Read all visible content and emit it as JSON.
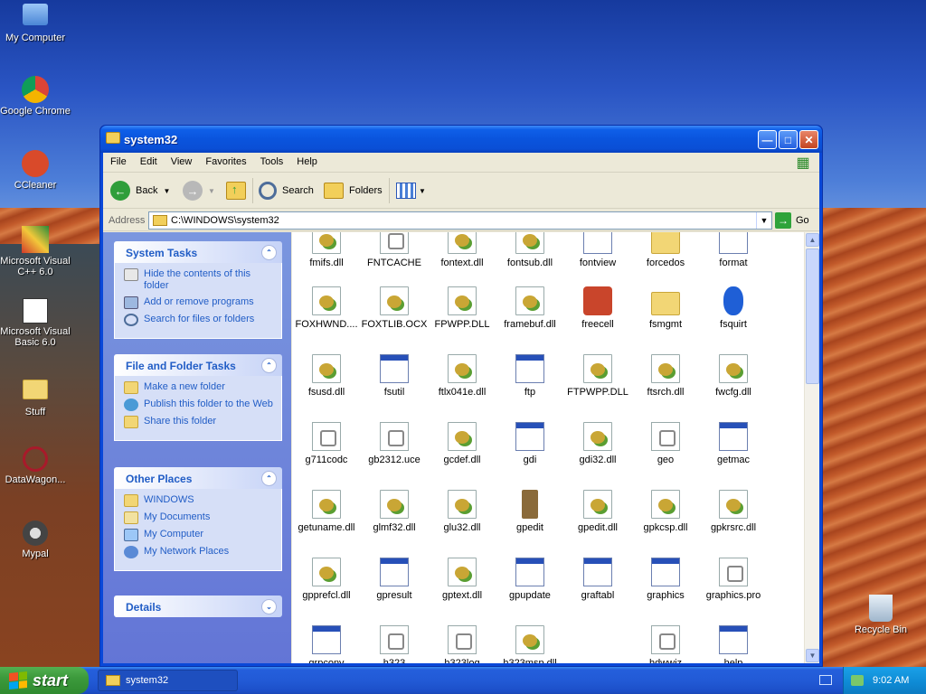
{
  "desktop": {
    "icons": [
      {
        "label": "My Computer",
        "icon": "computer-icon"
      },
      {
        "label": "Google Chrome",
        "icon": "chrome-icon"
      },
      {
        "label": "CCleaner",
        "icon": "ccleaner-icon"
      },
      {
        "label": "Microsoft Visual C++ 6.0",
        "icon": "visual-cpp-icon"
      },
      {
        "label": "Microsoft Visual Basic 6.0",
        "icon": "visual-basic-icon"
      },
      {
        "label": "Stuff",
        "icon": "folder-icon"
      },
      {
        "label": "DataWagon...",
        "icon": "datawagon-icon"
      },
      {
        "label": "Mypal",
        "icon": "mypal-icon"
      },
      {
        "label": "Recycle Bin",
        "icon": "recycle-bin-icon"
      }
    ]
  },
  "window": {
    "title": "system32",
    "menu": [
      "File",
      "Edit",
      "View",
      "Favorites",
      "Tools",
      "Help"
    ],
    "toolbar": {
      "back": "Back",
      "search": "Search",
      "folders": "Folders"
    },
    "address": {
      "label": "Address",
      "value": "C:\\WINDOWS\\system32",
      "go": "Go"
    }
  },
  "taskpane": {
    "system_tasks": {
      "title": "System Tasks",
      "items": [
        "Hide the contents of this folder",
        "Add or remove programs",
        "Search for files or folders"
      ]
    },
    "file_folder_tasks": {
      "title": "File and Folder Tasks",
      "items": [
        "Make a new folder",
        "Publish this folder to the Web",
        "Share this folder"
      ]
    },
    "other_places": {
      "title": "Other Places",
      "items": [
        "WINDOWS",
        "My Documents",
        "My Computer",
        "My Network Places"
      ]
    },
    "details": {
      "title": "Details"
    }
  },
  "files": [
    [
      "fmifs.dll",
      "FNTCACHE",
      "fontext.dll",
      "fontsub.dll",
      "fontview",
      "forcedos",
      "format"
    ],
    [
      "FOXHWND....",
      "FOXTLIB.OCX",
      "FPWPP.DLL",
      "framebuf.dll",
      "freecell",
      "fsmgmt",
      "fsquirt"
    ],
    [
      "fsusd.dll",
      "fsutil",
      "ftlx041e.dll",
      "ftp",
      "FTPWPP.DLL",
      "ftsrch.dll",
      "fwcfg.dll"
    ],
    [
      "g711codc",
      "gb2312.uce",
      "gcdef.dll",
      "gdi",
      "gdi32.dll",
      "geo",
      "getmac"
    ],
    [
      "getuname.dll",
      "glmf32.dll",
      "glu32.dll",
      "gpedit",
      "gpedit.dll",
      "gpkcsp.dll",
      "gpkrsrc.dll"
    ],
    [
      "gpprefcl.dll",
      "gpresult",
      "gptext.dll",
      "gpupdate",
      "graftabl",
      "graphics",
      "graphics.pro"
    ],
    [
      "grpconv",
      "h323",
      "h323log",
      "h323msp.dll",
      "",
      "hdwwiz",
      "help"
    ]
  ],
  "taskbar": {
    "start": "start",
    "task": "system32",
    "clock": "9:02 AM"
  }
}
